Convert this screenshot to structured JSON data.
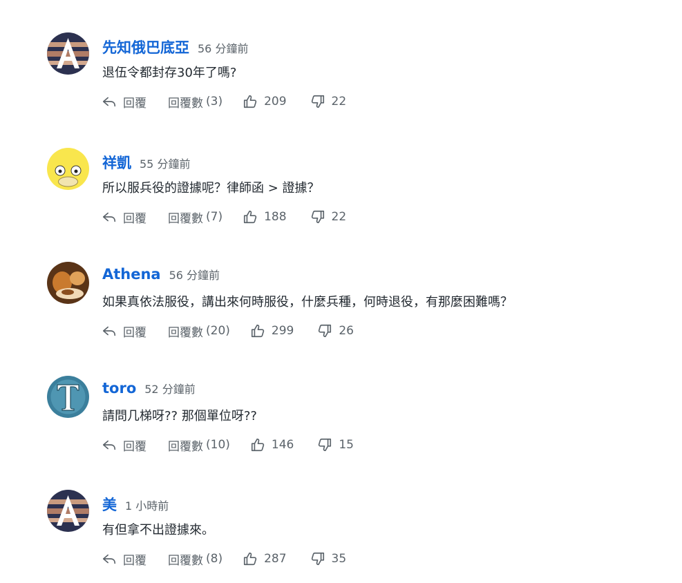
{
  "labels": {
    "reply": "回覆",
    "replies": "回覆數"
  },
  "comments": [
    {
      "username": "先知俄巴底亞",
      "time": "56 分鐘前",
      "text": "退伍令都封存30年了嗎?",
      "reply_count": "(3)",
      "likes": "209",
      "dislikes": "22",
      "avatar": "letter-a"
    },
    {
      "username": "祥凱",
      "time": "55 分鐘前",
      "text": "所以服兵役的證據呢？律師函 > 證據？",
      "reply_count": "(7)",
      "likes": "188",
      "dislikes": "22",
      "avatar": "yellow-duck"
    },
    {
      "username": "Athena",
      "time": "56 分鐘前",
      "text": "如果真依法服役，講出來何時服役，什麼兵種，何時退役，有那麼困難嗎？",
      "reply_count": "(20)",
      "likes": "299",
      "dislikes": "26",
      "avatar": "photo"
    },
    {
      "username": "toro",
      "time": "52 分鐘前",
      "text": "請問几梯呀?? 那個單位呀??",
      "reply_count": "(10)",
      "likes": "146",
      "dislikes": "15",
      "avatar": "letter-t"
    },
    {
      "username": "美",
      "time": "1 小時前",
      "text": "有但拿不出證據來。",
      "reply_count": "(8)",
      "likes": "287",
      "dislikes": "35",
      "avatar": "letter-a"
    }
  ],
  "colors": {
    "username": "#1366d6",
    "muted": "#5b636a",
    "text": "#232a31"
  }
}
